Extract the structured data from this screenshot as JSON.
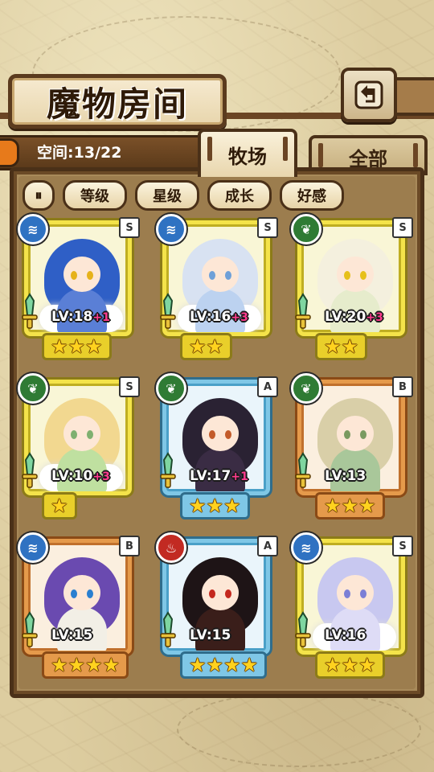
{
  "header": {
    "title": "魔物房间"
  },
  "info": {
    "space": "空间:13/22"
  },
  "tabs": [
    {
      "label": "牧场",
      "active": true
    },
    {
      "label": "全部",
      "active": false
    }
  ],
  "sort": {
    "toggle_label": "⏸",
    "buttons": [
      "等级",
      "星级",
      "成长",
      "好感"
    ]
  },
  "monsters": [
    {
      "level": "LV:18",
      "plus": "+1",
      "rank": "S",
      "element": "water",
      "stars": "★★★"
    },
    {
      "level": "LV:16",
      "plus": "+3",
      "rank": "S",
      "element": "water",
      "stars": "★★"
    },
    {
      "level": "LV:20",
      "plus": "+3",
      "rank": "S",
      "element": "wood",
      "stars": "★★"
    },
    {
      "level": "LV:10",
      "plus": "+3",
      "rank": "S",
      "element": "wood",
      "stars": "★"
    },
    {
      "level": "LV:17",
      "plus": "+1",
      "rank": "A",
      "element": "wood",
      "stars": "★★★"
    },
    {
      "level": "LV:13",
      "plus": "",
      "rank": "B",
      "element": "wood",
      "stars": "★★★"
    },
    {
      "level": "LV:15",
      "plus": "",
      "rank": "B",
      "element": "water",
      "stars": "★★★★"
    },
    {
      "level": "LV:15",
      "plus": "",
      "rank": "A",
      "element": "fire",
      "stars": "★★★★"
    },
    {
      "level": "LV:16",
      "plus": "",
      "rank": "S",
      "element": "water",
      "stars": "★★★"
    }
  ],
  "colors": {
    "rank_s": "#f4e34a",
    "rank_a": "#7fc7e6",
    "rank_b": "#e59a4b"
  },
  "icons": {
    "water": "water-waves-icon",
    "wood": "leaf-icon",
    "fire": "flame-icon",
    "back": "back-arrow-icon"
  }
}
